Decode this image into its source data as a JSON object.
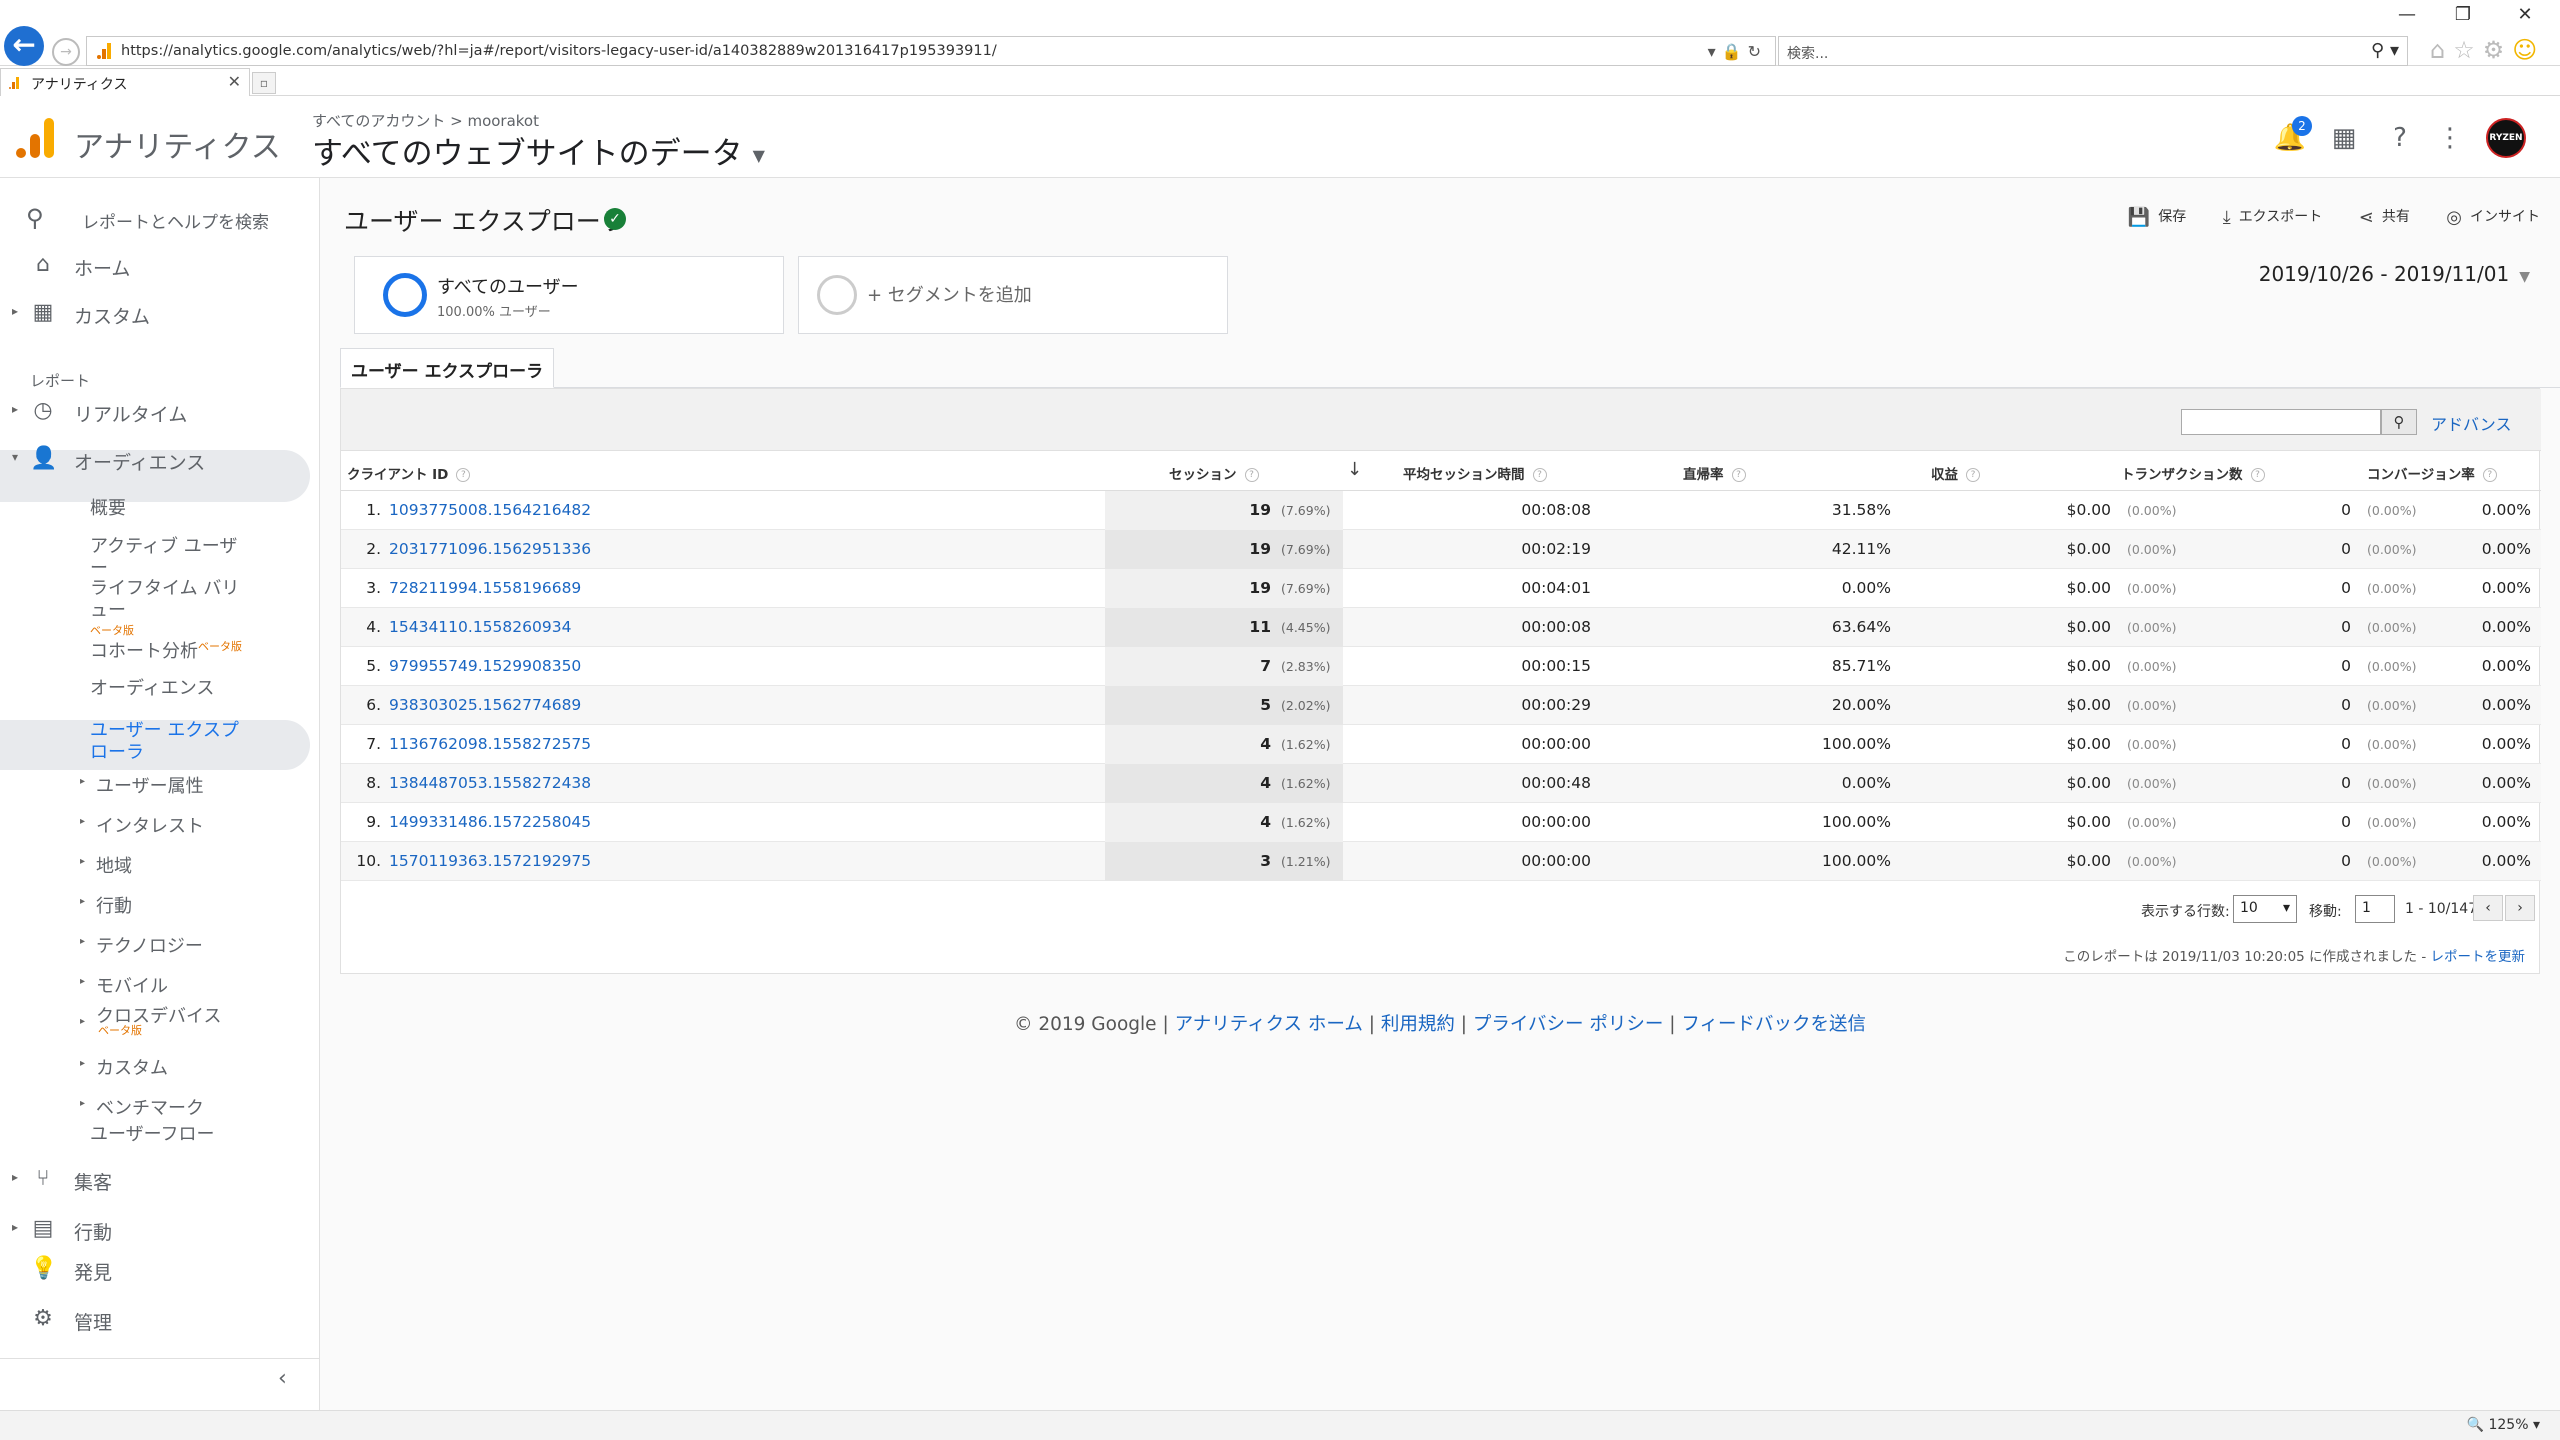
{
  "browser": {
    "url": "https://analytics.google.com/analytics/web/?hl=ja#/report/visitors-legacy-user-id/a140382889w201316417p195393911/",
    "search_placeholder": "検索...",
    "tab_title": "アナリティクス",
    "zoom": "125%"
  },
  "header": {
    "product": "アナリティクス",
    "breadcrumb": "すべてのアカウント > moorakot",
    "view": "すべてのウェブサイトのデータ",
    "notification_count": "2",
    "avatar_text": "RYZEN"
  },
  "sidebar": {
    "search_placeholder": "レポートとヘルプを検索",
    "home": "ホーム",
    "custom": "カスタム",
    "section_label": "レポート",
    "realtime": "リアルタイム",
    "audience": "オーディエンス",
    "audience_items": {
      "overview": "概要",
      "active_users": "アクティブ ユーザー",
      "lifetime_value": "ライフタイム バリュー",
      "lifetime_beta": "ベータ版",
      "cohort": "コホート分析",
      "cohort_beta": "ベータ版",
      "audiences": "オーディエンス",
      "user_explorer": "ユーザー エクスプローラ",
      "user_attributes": "ユーザー属性",
      "interests": "インタレスト",
      "geo": "地域",
      "behavior": "行動",
      "technology": "テクノロジー",
      "mobile": "モバイル",
      "cross_device": "クロスデバイス",
      "cross_device_beta": "ベータ版",
      "custom": "カスタム",
      "benchmark": "ベンチマーク",
      "users_flow": "ユーザーフロー"
    },
    "acquisition": "集客",
    "behavior": "行動",
    "discover": "発見",
    "admin": "管理"
  },
  "report": {
    "title": "ユーザー エクスプローラ",
    "actions": {
      "save": "保存",
      "export": "エクスポート",
      "share": "共有",
      "insights": "インサイト"
    },
    "segment_all": {
      "name": "すべてのユーザー",
      "sub": "100.00% ユーザー"
    },
    "segment_add": "+ セグメントを追加",
    "date_range": "2019/10/26 - 2019/11/01",
    "tab": "ユーザー エクスプローラ",
    "advanced": "アドバンス",
    "columns": {
      "client_id": "クライアント ID",
      "sessions": "セッション",
      "avg_duration": "平均セッション時間",
      "bounce": "直帰率",
      "revenue": "収益",
      "transactions": "トランザクション数",
      "conversion": "コンバージョン率"
    },
    "rows": [
      {
        "n": "1.",
        "id": "1093775008.1564216482",
        "s": "19",
        "sp": "(7.69%)",
        "d": "00:08:08",
        "b": "31.58%",
        "r": "$0.00",
        "rp": "(0.00%)",
        "t": "0",
        "tp": "(0.00%)",
        "c": "0.00%"
      },
      {
        "n": "2.",
        "id": "2031771096.1562951336",
        "s": "19",
        "sp": "(7.69%)",
        "d": "00:02:19",
        "b": "42.11%",
        "r": "$0.00",
        "rp": "(0.00%)",
        "t": "0",
        "tp": "(0.00%)",
        "c": "0.00%"
      },
      {
        "n": "3.",
        "id": "728211994.1558196689",
        "s": "19",
        "sp": "(7.69%)",
        "d": "00:04:01",
        "b": "0.00%",
        "r": "$0.00",
        "rp": "(0.00%)",
        "t": "0",
        "tp": "(0.00%)",
        "c": "0.00%"
      },
      {
        "n": "4.",
        "id": "15434110.1558260934",
        "s": "11",
        "sp": "(4.45%)",
        "d": "00:00:08",
        "b": "63.64%",
        "r": "$0.00",
        "rp": "(0.00%)",
        "t": "0",
        "tp": "(0.00%)",
        "c": "0.00%"
      },
      {
        "n": "5.",
        "id": "979955749.1529908350",
        "s": "7",
        "sp": "(2.83%)",
        "d": "00:00:15",
        "b": "85.71%",
        "r": "$0.00",
        "rp": "(0.00%)",
        "t": "0",
        "tp": "(0.00%)",
        "c": "0.00%"
      },
      {
        "n": "6.",
        "id": "938303025.1562774689",
        "s": "5",
        "sp": "(2.02%)",
        "d": "00:00:29",
        "b": "20.00%",
        "r": "$0.00",
        "rp": "(0.00%)",
        "t": "0",
        "tp": "(0.00%)",
        "c": "0.00%"
      },
      {
        "n": "7.",
        "id": "1136762098.1558272575",
        "s": "4",
        "sp": "(1.62%)",
        "d": "00:00:00",
        "b": "100.00%",
        "r": "$0.00",
        "rp": "(0.00%)",
        "t": "0",
        "tp": "(0.00%)",
        "c": "0.00%"
      },
      {
        "n": "8.",
        "id": "1384487053.1558272438",
        "s": "4",
        "sp": "(1.62%)",
        "d": "00:00:48",
        "b": "0.00%",
        "r": "$0.00",
        "rp": "(0.00%)",
        "t": "0",
        "tp": "(0.00%)",
        "c": "0.00%"
      },
      {
        "n": "9.",
        "id": "1499331486.1572258045",
        "s": "4",
        "sp": "(1.62%)",
        "d": "00:00:00",
        "b": "100.00%",
        "r": "$0.00",
        "rp": "(0.00%)",
        "t": "0",
        "tp": "(0.00%)",
        "c": "0.00%"
      },
      {
        "n": "10.",
        "id": "1570119363.1572192975",
        "s": "3",
        "sp": "(1.21%)",
        "d": "00:00:00",
        "b": "100.00%",
        "r": "$0.00",
        "rp": "(0.00%)",
        "t": "0",
        "tp": "(0.00%)",
        "c": "0.00%"
      }
    ],
    "pager": {
      "rows_label": "表示する行数:",
      "rows_value": "10",
      "goto_label": "移動:",
      "goto_value": "1",
      "range": "1 - 10/147"
    },
    "created_text": "このレポートは 2019/11/03 10:20:05 に作成されました -",
    "refresh": "レポートを更新"
  },
  "footer": {
    "copyright": "© 2019 Google",
    "links": [
      "アナリティクス ホーム",
      "利用規約",
      "プライバシー ポリシー",
      "フィードバックを送信"
    ]
  },
  "colors": {
    "accent": "#1a73e8",
    "link": "#1a66c2",
    "logo": "#f9ab00"
  }
}
